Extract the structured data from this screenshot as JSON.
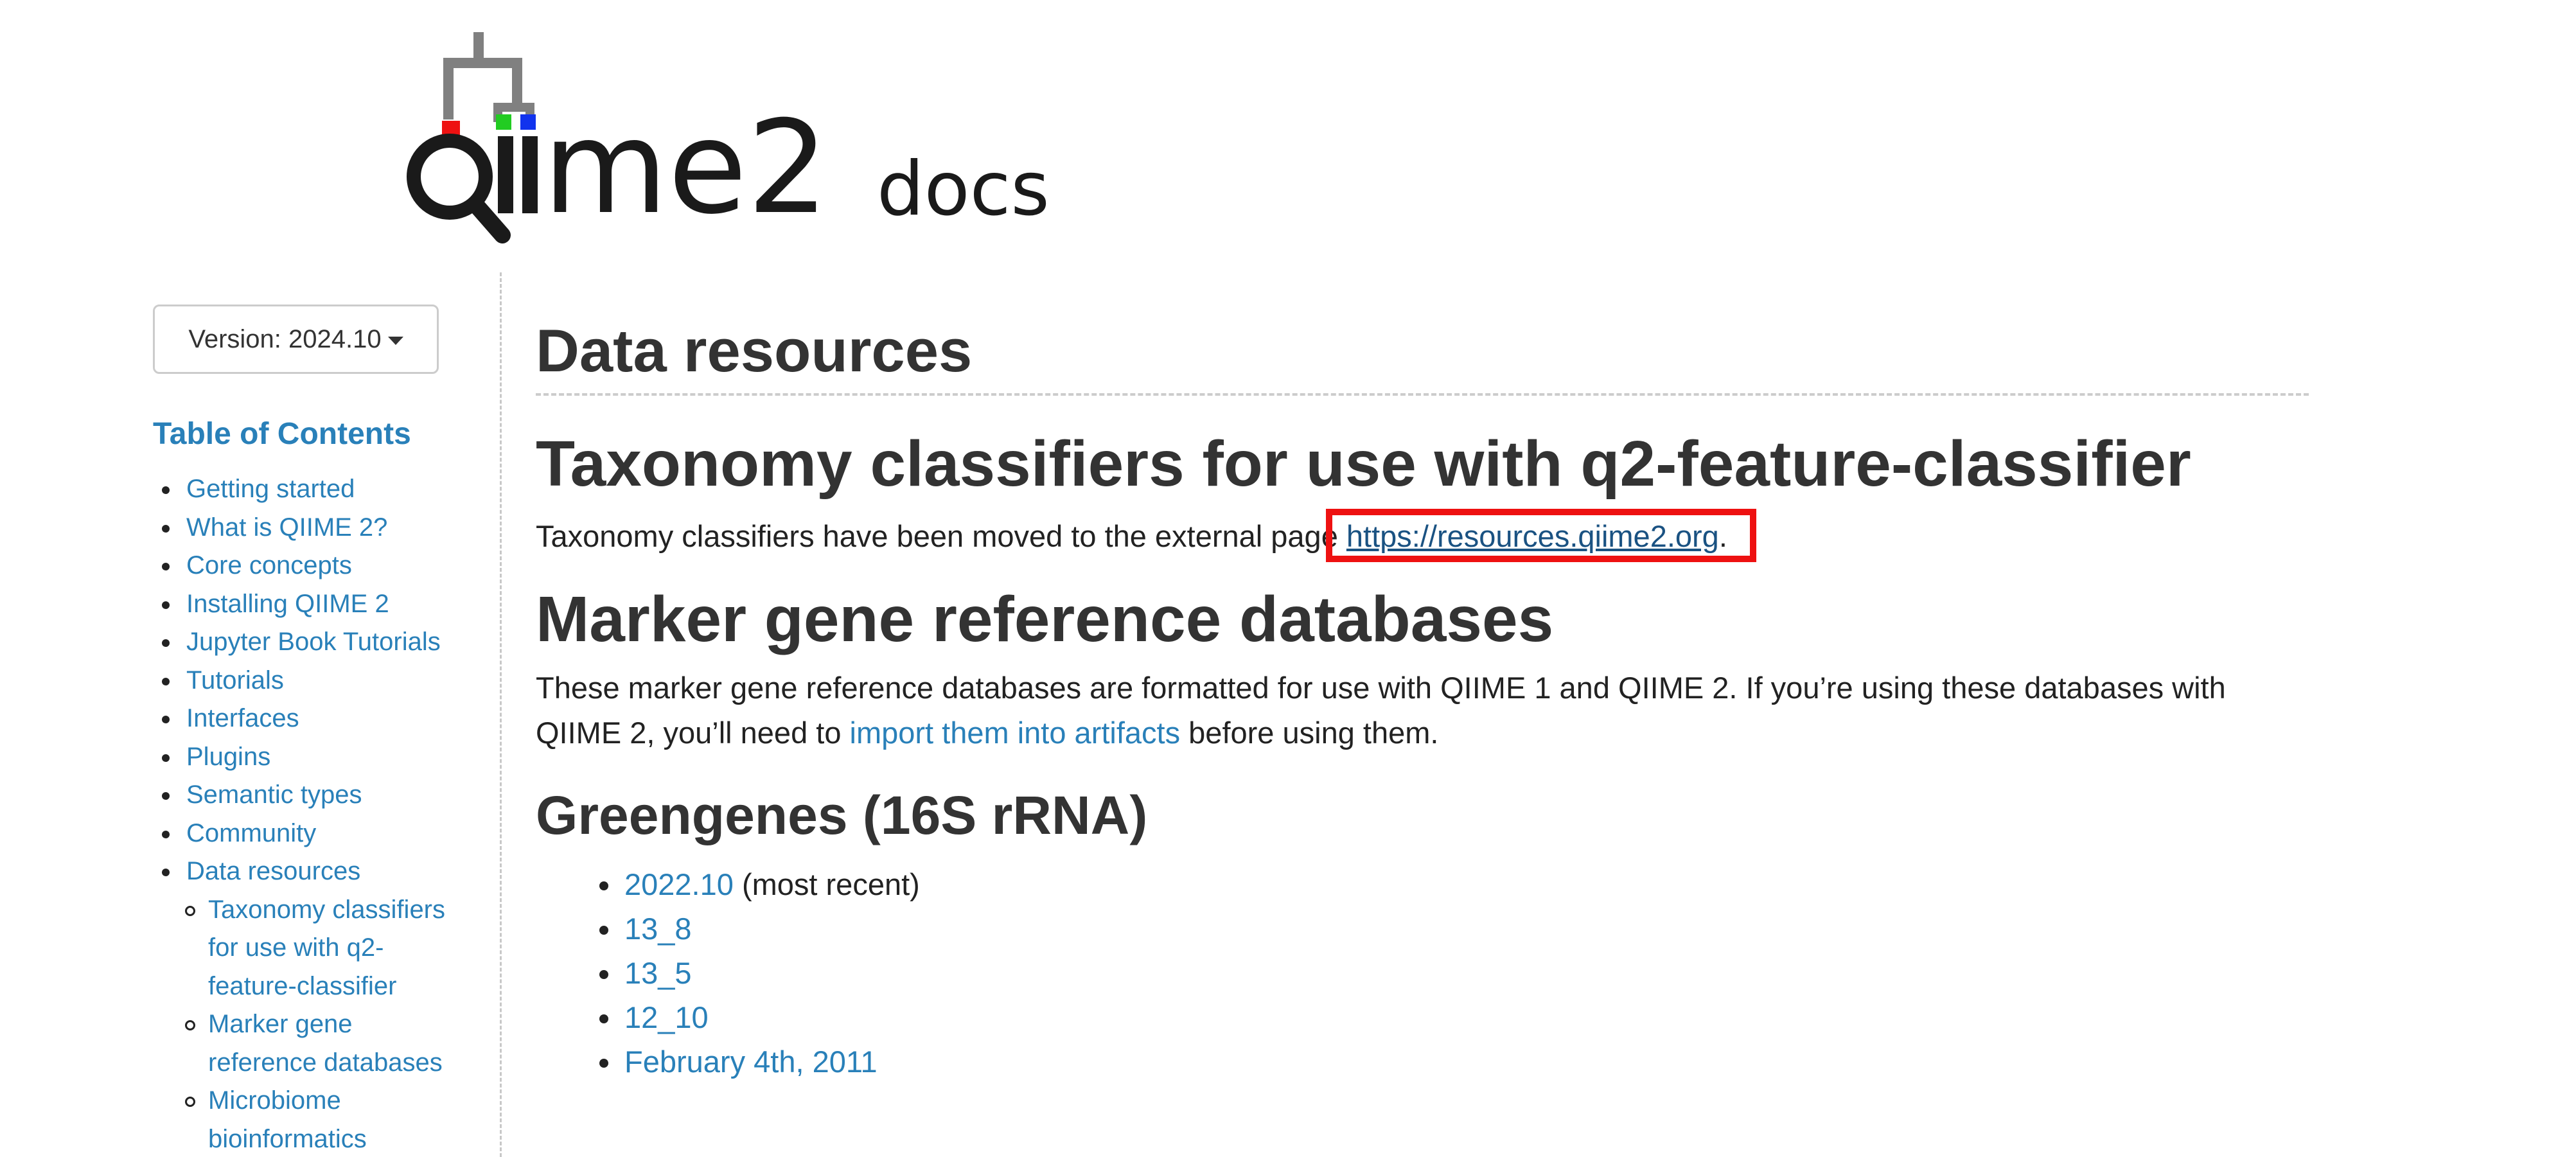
{
  "logo": {
    "text_main": "qiime2",
    "text_sub": "docs",
    "colors": {
      "dark": "#1a1a1a",
      "tree": "#808080",
      "red": "#ee1111",
      "green": "#22cc22",
      "blue": "#1133ee"
    }
  },
  "sidebar": {
    "version_label": "Version: 2024.10",
    "toc_title": "Table of Contents",
    "items": [
      {
        "label": "Getting started"
      },
      {
        "label": "What is QIIME 2?"
      },
      {
        "label": "Core concepts"
      },
      {
        "label": "Installing QIIME 2"
      },
      {
        "label": "Jupyter Book Tutorials"
      },
      {
        "label": "Tutorials"
      },
      {
        "label": "Interfaces"
      },
      {
        "label": "Plugins"
      },
      {
        "label": "Semantic types"
      },
      {
        "label": "Community"
      },
      {
        "label": "Data resources"
      }
    ],
    "subitems": [
      {
        "label": "Taxonomy classifiers for use with q2-feature-classifier"
      },
      {
        "label": "Marker gene reference databases"
      },
      {
        "label": "Microbiome bioinformatics"
      }
    ]
  },
  "main": {
    "page_title": "Data resources",
    "taxonomy": {
      "heading": "Taxonomy classifiers for use with q2-feature-classifier",
      "text_before": "Taxonomy classifiers have been moved to the external page ",
      "link": "https://resources.qiime2.org",
      "text_after": "."
    },
    "marker": {
      "heading": "Marker gene reference databases",
      "text_before": "These marker gene reference databases are formatted for use with QIIME 1 and QIIME 2. If you’re using these databases with QIIME 2, you’ll need to ",
      "link": "import them into artifacts",
      "text_after": " before using them."
    },
    "greengenes": {
      "heading": "Greengenes (16S rRNA)",
      "items": [
        {
          "link": "2022.10",
          "note": " (most recent)"
        },
        {
          "link": "13_8",
          "note": ""
        },
        {
          "link": "13_5",
          "note": ""
        },
        {
          "link": "12_10",
          "note": ""
        },
        {
          "link": "February 4th, 2011",
          "note": ""
        }
      ]
    }
  },
  "highlight_color": "#ee1111"
}
